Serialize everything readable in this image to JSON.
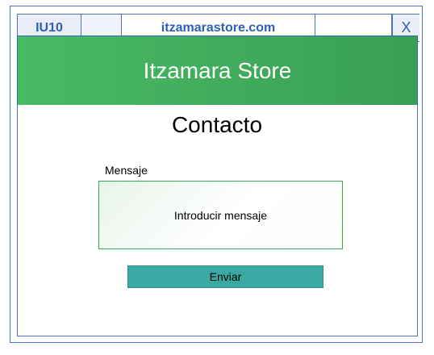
{
  "browser": {
    "tab_id": "IU10",
    "url": "itzamarastore.com",
    "close": "X"
  },
  "header": {
    "title": "Itzamara Store"
  },
  "page": {
    "title": "Contacto",
    "message_label": "Mensaje",
    "message_placeholder": "Introducir mensaje",
    "send_label": "Enviar"
  },
  "colors": {
    "header_green": "#47ba63",
    "button_teal": "#3aa8a3",
    "frame_blue": "#4a74c2"
  }
}
